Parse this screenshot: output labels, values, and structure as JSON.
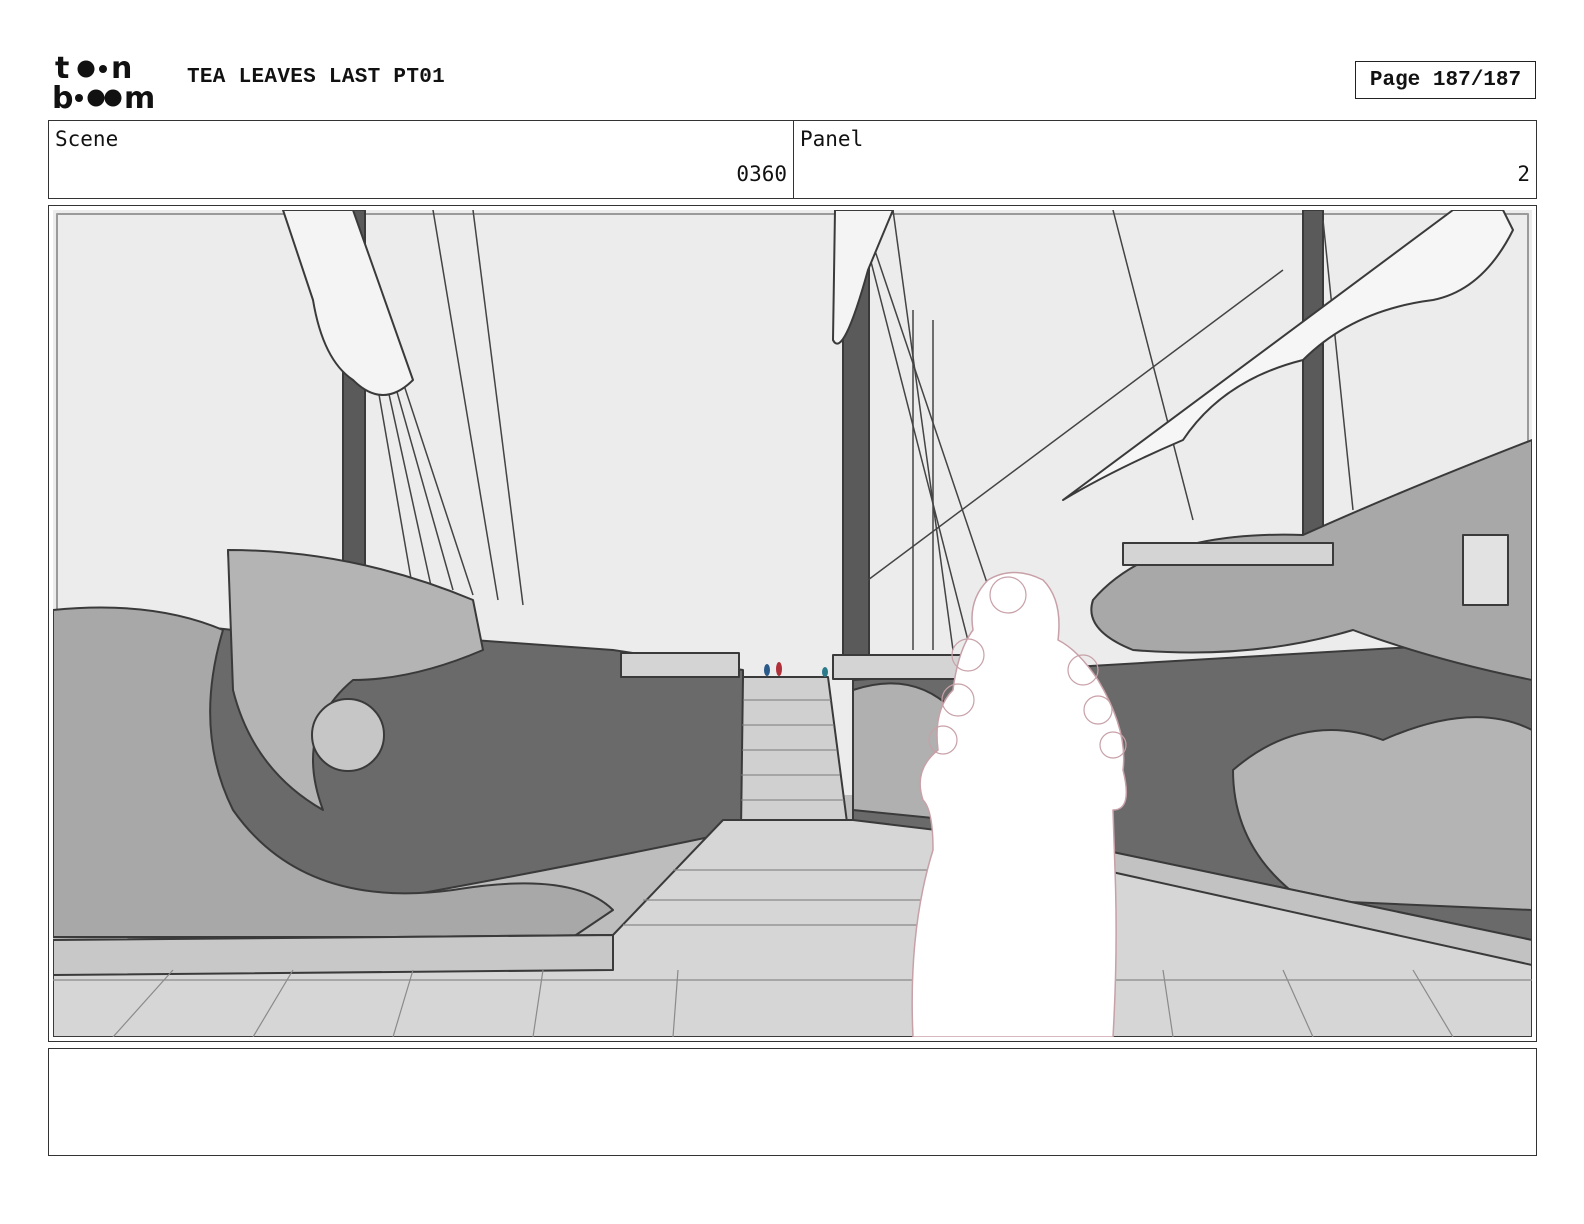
{
  "header": {
    "logo_text_top": "toon",
    "logo_text_bottom": "boom",
    "project_title": "TEA LEAVES LAST PT01",
    "page_counter": "Page 187/187"
  },
  "info": {
    "scene_label": "Scene",
    "scene_value": "0360",
    "panel_label": "Panel",
    "panel_value": "2"
  },
  "panel": {
    "description": "",
    "colors": {
      "sky": "#ececec",
      "sea": "#bdbdbd",
      "hull": "#6a6a6a",
      "carving": "#a8a8a8",
      "deck": "#d6d6d6",
      "figure": "#ffffff",
      "accent_red": "#b0303a",
      "accent_blue": "#2a5a8a"
    }
  },
  "notes": {
    "text": ""
  }
}
